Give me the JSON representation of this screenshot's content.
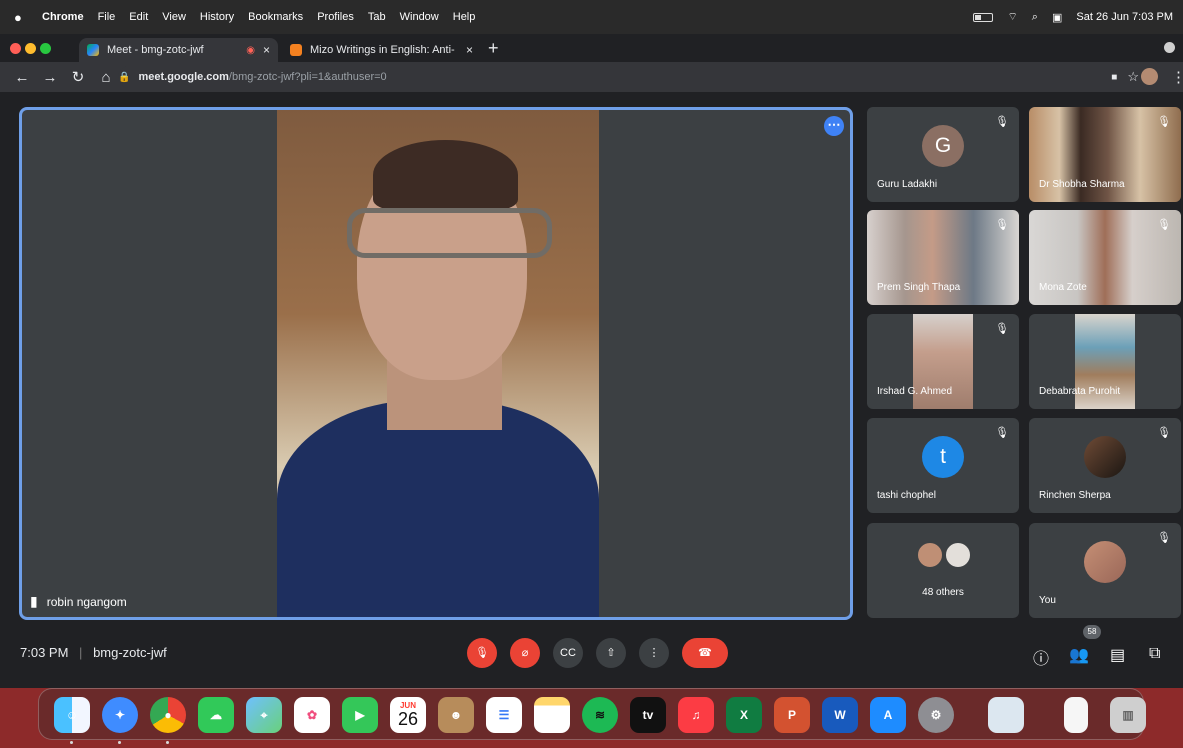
{
  "menubar": {
    "app": "Chrome",
    "menus": [
      "File",
      "Edit",
      "View",
      "History",
      "Bookmarks",
      "Profiles",
      "Tab",
      "Window",
      "Help"
    ],
    "clock": "Sat 26 Jun  7:03 PM"
  },
  "browser": {
    "tabs": [
      {
        "title": "Meet - bmg-zotc-jwf"
      },
      {
        "title": "Mizo Writings in English: Anti-"
      }
    ],
    "new_tab": "+",
    "address": {
      "host": "meet.google.com",
      "path": "/bmg-zotc-jwf?pli=1&authuser=0"
    }
  },
  "meet": {
    "main_participant": "robin ngangom",
    "meeting_code": "bmg-zotc-jwf",
    "time": "7:03 PM",
    "participants_count": "58",
    "tiles": [
      {
        "name": "Guru Ladakhi",
        "initial": "G",
        "avatar_color": "#8b6f63"
      },
      {
        "name": "Dr Shobha Sharma"
      },
      {
        "name": "Prem Singh Thapa"
      },
      {
        "name": "Mona Zote"
      },
      {
        "name": "Irshad G. Ahmed"
      },
      {
        "name": "Debabrata Purohit"
      },
      {
        "name": "tashi chophel",
        "initial": "t",
        "avatar_color": "#1e88e5"
      },
      {
        "name": "Rinchen Sherpa"
      },
      {
        "name": "48 others"
      },
      {
        "name": "You"
      }
    ],
    "controls": [
      "mic-off",
      "camera-off",
      "captions",
      "present",
      "more",
      "leave"
    ]
  },
  "dock": {
    "calendar_month": "JUN",
    "calendar_day": "26",
    "tv_label": "tv",
    "apps": [
      "Finder",
      "Safari",
      "Chrome",
      "Messages",
      "Maps",
      "Photos",
      "FaceTime",
      "Calendar",
      "Contacts",
      "Reminders",
      "Notes",
      "Spotify",
      "TV",
      "Music",
      "Excel",
      "PowerPoint",
      "Word",
      "App Store",
      "System Preferences",
      "Preview",
      "Document",
      "Trash"
    ]
  }
}
